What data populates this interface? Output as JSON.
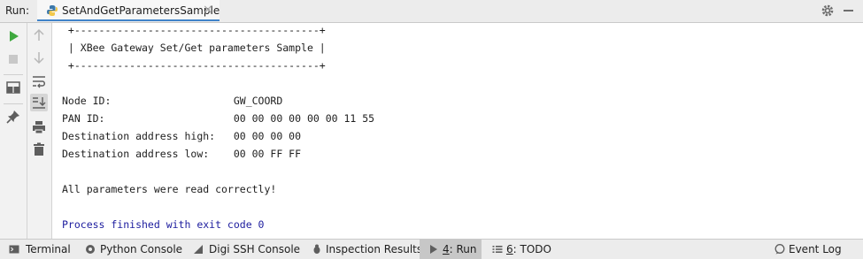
{
  "header": {
    "run_label": "Run:",
    "tab_title": "SetAndGetParametersSample",
    "tab_close": "×",
    "settings_icon": "gear-icon",
    "minimize_icon": "minimize-icon"
  },
  "left_toolbar": {
    "icons": [
      "run-icon",
      "stop-icon",
      "layout-icon",
      "pin-icon"
    ]
  },
  "right_toolbar": {
    "icons": [
      "arrow-up-icon",
      "arrow-down-icon",
      "soft-wrap-icon",
      "scroll-to-end-icon",
      "print-icon",
      "trash-icon"
    ]
  },
  "console": {
    "lines": [
      " +----------------------------------------+",
      " | XBee Gateway Set/Get parameters Sample |",
      " +----------------------------------------+",
      "",
      "Node ID:                    GW_COORD",
      "PAN ID:                     00 00 00 00 00 00 11 55",
      "Destination address high:   00 00 00 00",
      "Destination address low:    00 00 FF FF",
      "",
      "All parameters were read correctly!",
      "",
      "Process finished with exit code 0"
    ]
  },
  "bottom_bar": {
    "tabs": [
      {
        "label": "Terminal",
        "icon": "terminal-icon"
      },
      {
        "label": "Python Console",
        "icon": "python-console-icon"
      },
      {
        "label": "Digi SSH Console",
        "icon": "ssh-console-icon"
      },
      {
        "label": "Inspection Results",
        "icon": "inspection-icon"
      },
      {
        "mnemonic": "4",
        "label": ": Run",
        "icon": "run-tab-icon"
      },
      {
        "mnemonic": "6",
        "label": ": TODO",
        "icon": "todo-icon"
      },
      {
        "label": "Event Log",
        "icon": "event-log-icon"
      }
    ]
  },
  "colors": {
    "accent": "#4083c9",
    "run_green": "#3ea83e",
    "exit_text": "#1c1c9e"
  }
}
